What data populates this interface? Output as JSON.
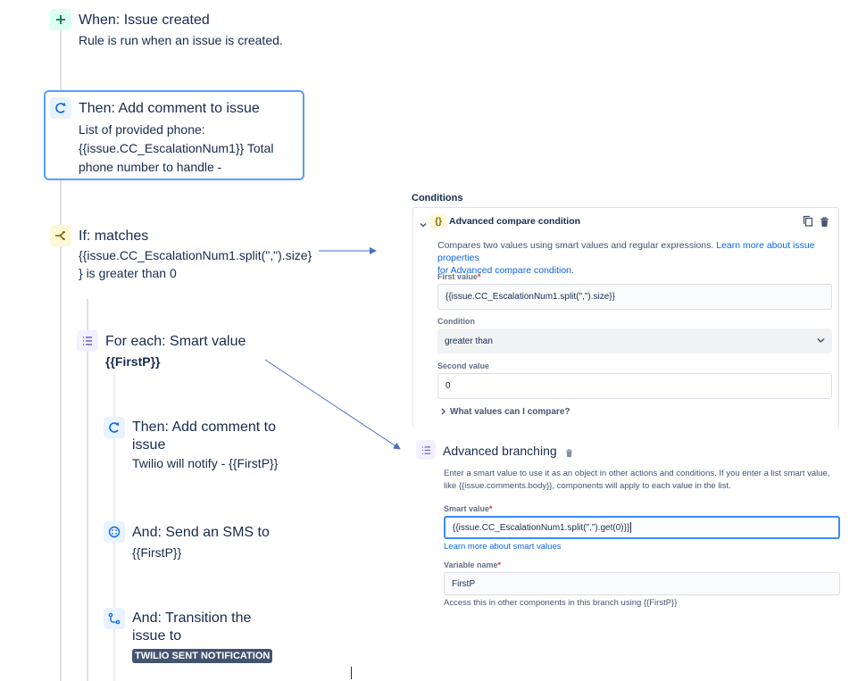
{
  "trigger": {
    "title": "When: Issue created",
    "desc": "Rule is run when an issue is created."
  },
  "action1": {
    "title": "Then: Add comment to issue",
    "desc_lines": [
      "List of provided phone:",
      "{{issue.CC_EscalationNum1}} Total",
      "phone number to handle -"
    ]
  },
  "condition": {
    "title": "If: matches",
    "desc_lines": [
      "{{issue.CC_EscalationNum1.split(\",\").size}",
      "} is greater than 0"
    ]
  },
  "branch": {
    "title": "For each: Smart value",
    "value": "{{FirstP}}"
  },
  "branch_action1": {
    "title_lines": [
      "Then: Add comment to",
      "issue"
    ],
    "desc": "Twilio will notify - {{FirstP}}"
  },
  "branch_action2": {
    "title": "And: Send an SMS to",
    "desc": "{{FirstP}}"
  },
  "branch_action3": {
    "title_lines": [
      "And: Transition the",
      "issue to"
    ],
    "status": "TWILIO SENT NOTIFICATION"
  },
  "conditions_panel": {
    "heading": "Conditions",
    "item_title": "Advanced compare condition",
    "desc_text": "Compares two values using smart values and regular expressions. ",
    "desc_link_1": "Learn more about issue properties",
    "desc_link_2": "for Advanced compare condition.",
    "first_label": "First value",
    "first_value": "{{issue.CC_EscalationNum1.split(\",\").size}}",
    "condition_label": "Condition",
    "condition_value": "greater than",
    "second_label": "Second value",
    "second_value": "0",
    "expander": "What values can I compare?"
  },
  "branching_panel": {
    "title": "Advanced branching",
    "desc_line1": "Enter a smart value to use it as an object in other actions and conditions. If you enter a list smart value,",
    "desc_line2": "like {{issue.comments.body}}, components will apply to each value in the list.",
    "smart_label": "Smart value",
    "smart_value": "{{issue.CC_EscalationNum1.split(\",\").get(0)}}",
    "smart_link": "Learn more about smart values",
    "var_label": "Variable name",
    "var_value": "FirstP",
    "helper": "Access this in other components in this branch using {{FirstP}}"
  },
  "colors": {
    "accent": "#579dff",
    "link": "#0c66e4",
    "lozenge": "#44546f",
    "arrow": "#4a6fc9"
  }
}
